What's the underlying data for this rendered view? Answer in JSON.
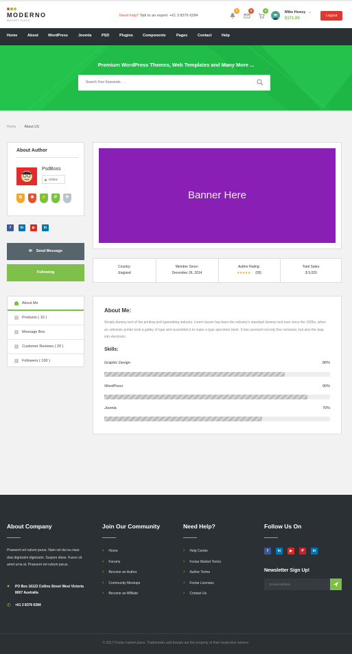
{
  "brand": {
    "name": "MODERNO",
    "tagline": "MARKET PLACE"
  },
  "header": {
    "help_label": "Need help?",
    "help_text": "Talk to an expert: +61 3 8376 6284",
    "notif_counts": [
      "0",
      "5",
      "4"
    ],
    "user_name": "Mike Hussy",
    "balance": "$171.00",
    "logout_label": "Logout"
  },
  "nav": [
    "Home",
    "About",
    "WordPress",
    "Joomla",
    "PSD",
    "Plugins",
    "Components",
    "Pages",
    "Contact",
    "Help"
  ],
  "hero": {
    "title": "Premium WordPress Themes, Web Templates and Many More ...",
    "search_placeholder": "Search Your Keywords . . ."
  },
  "breadcrumb": {
    "home": "Home",
    "sep": "-",
    "current": "About US"
  },
  "author": {
    "heading": "About Author",
    "name": "PsdBoss",
    "status": "Online",
    "badge_glyphs": [
      "B",
      "✱",
      "⚡",
      "P",
      "⚑"
    ],
    "badge_colors": [
      "#f5a623",
      "#e2542f",
      "#7ac142",
      "#7ac142",
      "#b8c4cf"
    ]
  },
  "social": [
    "f",
    "in",
    "▶",
    "in"
  ],
  "buttons": {
    "send_message": "Send Message",
    "following": "Following"
  },
  "side_menu": [
    "About Me",
    "Products ( 10 )",
    "Message Box",
    "Customer Reviews ( 20 )",
    "Followers ( 100 )"
  ],
  "banner": "Banner Here",
  "stats": [
    {
      "label": "Country:",
      "value": "England"
    },
    {
      "label": "Member Since:",
      "value": "December 26, 2014"
    },
    {
      "label": "Author Rating:",
      "value": "(05)",
      "stars": 5
    },
    {
      "label": "Total Sales:",
      "value": "$ 5,020"
    }
  ],
  "about": {
    "heading": "About Me:",
    "text": "Simply dummy text of the printing and typesetting industry. Lorem Ipsum has been the industry's standard dummy text ever since the 1500s, when an unknown printer took a galley of type and scrambled it to make a type specimen book. It has survived not only five centuries, but also the leap into electronic.",
    "skills_heading": "Skills:"
  },
  "skills": [
    {
      "name": "Graphic Design",
      "percent_label": "80%",
      "level": 0.8
    },
    {
      "name": "WordPress",
      "percent_label": "90%",
      "level": 0.9
    },
    {
      "name": "Joomla",
      "percent_label": "70%",
      "level": 0.7
    }
  ],
  "footer": {
    "about": {
      "heading": "About Company",
      "text": "Praesent vel rutrum purus. Nam vel dui eu risus duis dignissim dignissim. Suspen disse. Fusce sit amet urna at. Praesent vel rutrum purus.",
      "address": "PO Box 16122 Collins Street West Victoria 8007 Australia",
      "phone": "+61 3 8376 6284"
    },
    "community": {
      "heading": "Join Our Community",
      "links": [
        "Home",
        "Forums",
        "Become an Author",
        "Community Meetups",
        "Become an Affiliate"
      ]
    },
    "help": {
      "heading": "Need Help?",
      "links": [
        "Help Center",
        "Foxtar Market Terms",
        "Author Terms",
        "Foxtar Licenses",
        "Contact Us"
      ]
    },
    "follow": {
      "heading": "Follow Us On",
      "newsletter_heading": "Newsletter Sign Up!",
      "email_placeholder": "E-mail Address"
    },
    "copyright": "© 2017 Foxtar market place. Trademarks and brands are the property of their respective owners."
  },
  "colors": {
    "accent_green": "#7ac142",
    "hero_green": "#22bd49",
    "banner_purple": "#8a1fb5",
    "logout_red": "#e2372f",
    "dark": "#2b3034"
  }
}
